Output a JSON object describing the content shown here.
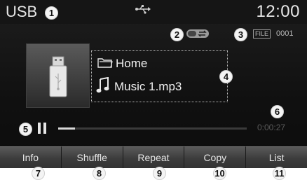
{
  "status_bar": {
    "source": "USB",
    "clock": "12:00",
    "usb_icon": "usb-icon"
  },
  "indicators": {
    "mode_icon": "repeat-shuffle-mode-icon",
    "file_badge": "FILE",
    "file_number": "0001"
  },
  "track": {
    "folder_icon": "folder-icon",
    "folder": "Home",
    "music_icon": "music-note-icon",
    "title": "Music 1.mp3"
  },
  "playback": {
    "state_icon": "pause-icon",
    "elapsed": "0:00:27",
    "progress_fraction": 0.09
  },
  "menu": {
    "items": [
      "Info",
      "Shuffle",
      "Repeat",
      "Copy",
      "List"
    ]
  },
  "callouts": [
    "1",
    "2",
    "3",
    "4",
    "5",
    "6",
    "7",
    "8",
    "9",
    "10",
    "11"
  ]
}
